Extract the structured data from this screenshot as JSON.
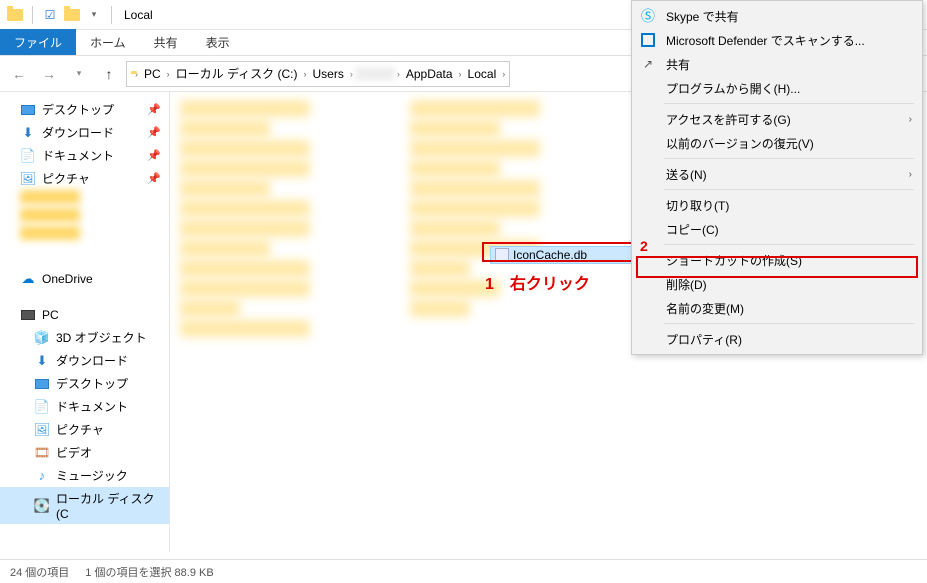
{
  "titlebar": {
    "title": "Local"
  },
  "ribbon": {
    "file": "ファイル",
    "home": "ホーム",
    "share": "共有",
    "view": "表示"
  },
  "breadcrumb": {
    "pc": "PC",
    "cdrive": "ローカル ディスク (C:)",
    "users": "Users",
    "appdata": "AppData",
    "local": "Local"
  },
  "sidebar": {
    "desktop": "デスクトップ",
    "download": "ダウンロード",
    "documents": "ドキュメント",
    "pictures": "ピクチャ",
    "onedrive": "OneDrive",
    "pc": "PC",
    "objects3d": "3D オブジェクト",
    "download2": "ダウンロード",
    "desktop2": "デスクトップ",
    "documents2": "ドキュメント",
    "pictures2": "ピクチャ",
    "video": "ビデオ",
    "music": "ミュージック",
    "cdrive": "ローカル ディスク (C"
  },
  "selected_file": {
    "name": "IconCache.db"
  },
  "context_menu": {
    "skype": "Skype で共有",
    "defender": "Microsoft Defender でスキャンする...",
    "share": "共有",
    "openwith": "プログラムから開く(H)...",
    "access": "アクセスを許可する(G)",
    "restore": "以前のバージョンの復元(V)",
    "sendto": "送る(N)",
    "cut": "切り取り(T)",
    "copy": "コピー(C)",
    "shortcut": "ショートカットの作成(S)",
    "delete": "削除(D)",
    "rename": "名前の変更(M)",
    "properties": "プロパティ(R)"
  },
  "annotations": {
    "one": "1　右クリック",
    "two": "2"
  },
  "statusbar": {
    "items": "24 個の項目",
    "selected": "1 個の項目を選択 88.9 KB"
  }
}
